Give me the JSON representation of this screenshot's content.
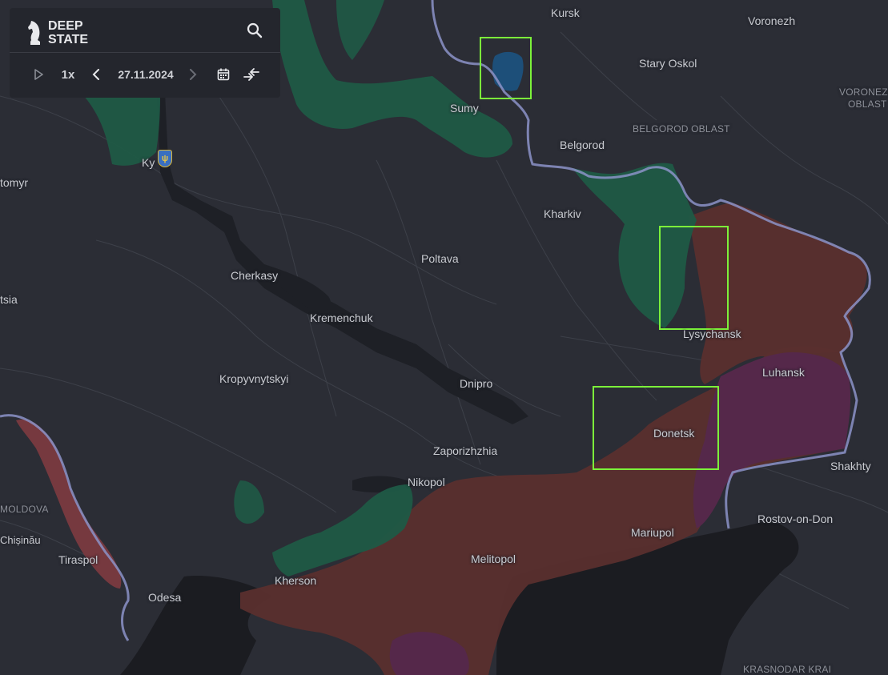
{
  "app": {
    "logo_line1": "DEEP",
    "logo_line2": "STATE"
  },
  "toolbar": {
    "speed": "1x",
    "date": "27.11.2024"
  },
  "colors": {
    "background": "#2b2d35",
    "ukraine_controlled": "#1f5a46",
    "russian_occupied": "#5a2f2e",
    "russian_occupied_since_2014": "#55284a",
    "border": "#8c93c8",
    "highlight": "#7cf23a",
    "kursk_incursion": "#1d4f79"
  },
  "cities": [
    {
      "name": "Kursk"
    },
    {
      "name": "Voronezh"
    },
    {
      "name": "Stary Oskol"
    },
    {
      "name": "Sumy"
    },
    {
      "name": "Belgorod"
    },
    {
      "name": "Kharkiv"
    },
    {
      "name": "Ky"
    },
    {
      "name": "tomyr"
    },
    {
      "name": "Poltava"
    },
    {
      "name": "Cherkasy"
    },
    {
      "name": "tsia"
    },
    {
      "name": "Kremenchuk"
    },
    {
      "name": "Lysychansk"
    },
    {
      "name": "Luhansk"
    },
    {
      "name": "Kropyvnytskyi"
    },
    {
      "name": "Dnipro"
    },
    {
      "name": "Donetsk"
    },
    {
      "name": "Zaporizhzhia"
    },
    {
      "name": "Shakhty"
    },
    {
      "name": "Nikopol"
    },
    {
      "name": "Rostov-on-Don"
    },
    {
      "name": "Chișinău"
    },
    {
      "name": "Mariupol"
    },
    {
      "name": "Tiraspol"
    },
    {
      "name": "Melitopol"
    },
    {
      "name": "Kherson"
    },
    {
      "name": "Odesa"
    }
  ],
  "regions": [
    {
      "name": "BELGOROD OBLAST"
    },
    {
      "name": "VORONEZH"
    },
    {
      "name": "OBLAST"
    },
    {
      "name": "MOLDOVA"
    },
    {
      "name": "KRASNODAR KRAI"
    }
  ]
}
